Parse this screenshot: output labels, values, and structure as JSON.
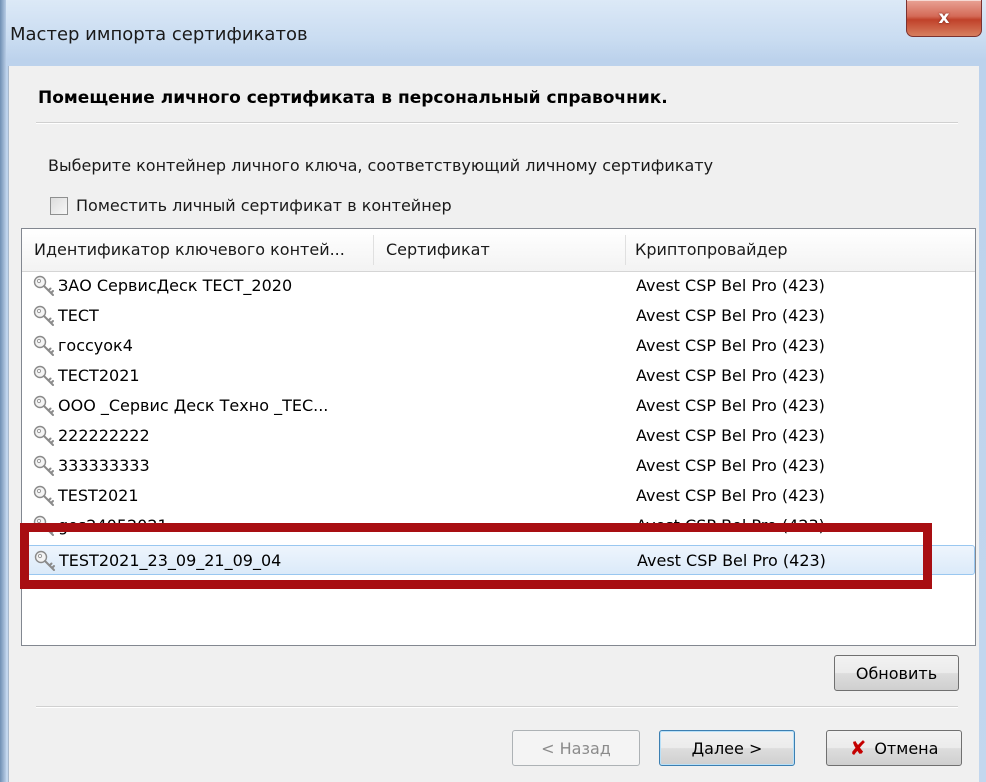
{
  "window": {
    "title": "Мастер импорта сертификатов",
    "close_label": "x"
  },
  "page": {
    "heading": "Помещение личного сертификата в персональный справочник.",
    "instruction": "Выберите контейнер личного ключа, соответствующий личному сертификату",
    "checkbox_label": "Поместить личный сертификат в контейнер",
    "checkbox_checked": false
  },
  "list": {
    "columns": [
      "Идентификатор ключевого контей...",
      "Сертификат",
      "Криптопровайдер"
    ],
    "rows": [
      {
        "id": "ЗАО СервисДеск ТЕСТ_2020",
        "cert": "",
        "provider": "Avest CSP Bel Pro (423)"
      },
      {
        "id": "ТЕСТ",
        "cert": "",
        "provider": "Avest CSP Bel Pro (423)"
      },
      {
        "id": "госсуок4",
        "cert": "",
        "provider": "Avest CSP Bel Pro (423)"
      },
      {
        "id": "ТЕСТ2021",
        "cert": "",
        "provider": "Avest CSP Bel Pro (423)"
      },
      {
        "id": "ООО _Сервис Деск Техно _ТЕС...",
        "cert": "",
        "provider": "Avest CSP Bel Pro (423)"
      },
      {
        "id": "222222222",
        "cert": "",
        "provider": "Avest CSP Bel Pro (423)"
      },
      {
        "id": "333333333",
        "cert": "",
        "provider": "Avest CSP Bel Pro (423)"
      },
      {
        "id": "TEST2021",
        "cert": "",
        "provider": "Avest CSP Bel Pro (423)"
      },
      {
        "id": "gos24052021",
        "cert": "",
        "provider": "Avest CSP Bel Pro (423)"
      },
      {
        "id": "TEST2021_23_09_21_09_04",
        "cert": "",
        "provider": "Avest CSP Bel Pro (423)"
      }
    ],
    "selected_index": 9,
    "icon": "key-icon"
  },
  "buttons": {
    "refresh": "Обновить",
    "back": "< Назад",
    "next": "Далее >",
    "cancel": "Отмена",
    "cancel_icon": "✘"
  },
  "colors": {
    "highlight": "#a80e12",
    "selection": "#dbeaf9"
  }
}
